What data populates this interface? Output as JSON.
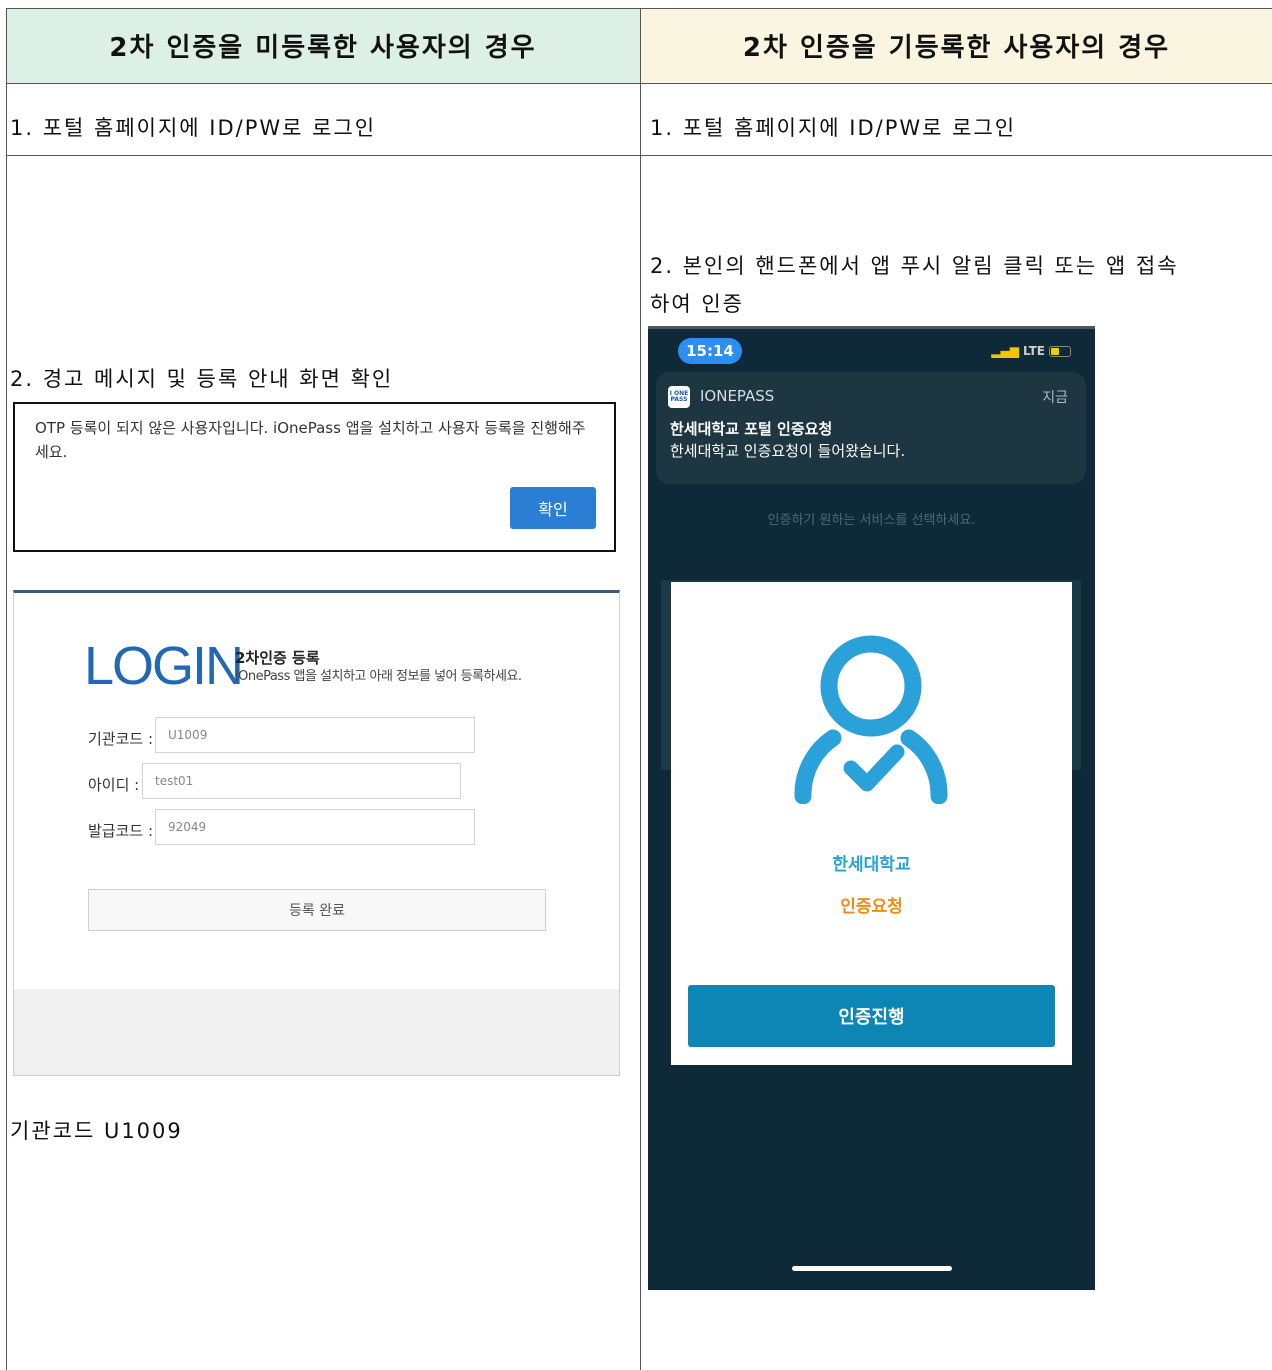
{
  "table": {
    "left_header": "2차 인증을 미등록한 사용자의 경우",
    "right_header": "2차 인증을 기등록한 사용자의 경우",
    "left_step1": "1. 포털 홈페이지에 ID/PW로 로그인",
    "right_step1": "1. 포털 홈페이지에 ID/PW로 로그인",
    "left_step2": "2. 경고 메시지 및 등록 안내 화면 확인",
    "right_step2_line1": "2. 본인의 핸드폰에서 앱 푸시 알림 클릭 또는 앱 접속",
    "right_step2_line2": "하여 인증",
    "left_note": "기관코드 U1009"
  },
  "alert": {
    "message": "OTP 등록이 되지 않은 사용자입니다. iOnePass 앱을 설치하고 사용자 등록을 진행해주세요.",
    "confirm_label": "확인"
  },
  "login": {
    "title": "LOGIN",
    "subtitle_heading": "2차인증 등록",
    "subtitle": "iOnePass 앱을 설치하고 아래 정보를 넣어 등록하세요.",
    "fields": [
      {
        "label": "기관코드 :",
        "value": "U1009"
      },
      {
        "label": "아이디 :",
        "value": "test01"
      },
      {
        "label": "발급코드 :",
        "value": "92049"
      }
    ],
    "submit_label": "등록 완료"
  },
  "phone": {
    "time": "15:14",
    "network": "LTE",
    "notification": {
      "app_name": "IONEPASS",
      "time": "지금",
      "title": "한세대학교 포털 인증요청",
      "body": "한세대학교 인증요청이 들어왔습니다."
    },
    "hint": "인증하기 원하는 서비스를 선택하세요.",
    "card": {
      "org": "한세대학교",
      "request": "인증요청",
      "button": "인증진행"
    }
  },
  "colors": {
    "left_header_bg": "#dcf0e6",
    "right_header_bg": "#f9f5e0",
    "phone_bg": "#0e2a38",
    "accent_blue": "#2aa1d8",
    "accent_orange": "#f08c14",
    "button_blue": "#0d86b5"
  }
}
